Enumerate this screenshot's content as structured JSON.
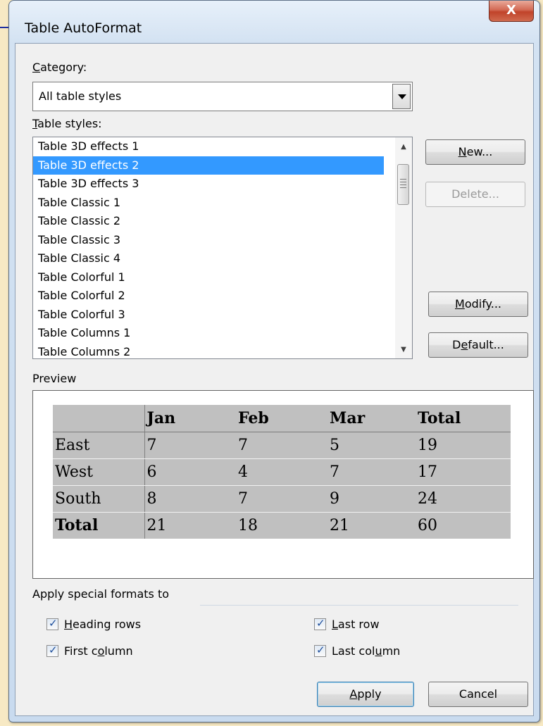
{
  "dialog": {
    "title": "Table AutoFormat",
    "close_symbol": "X"
  },
  "category": {
    "label_ul": "C",
    "label_rest": "ategory:",
    "value": "All table styles"
  },
  "table_styles": {
    "label_ul": "T",
    "label_rest": "able styles:",
    "selected_index": 1,
    "items": [
      "Table 3D effects 1",
      "Table 3D effects 2",
      "Table 3D effects 3",
      "Table Classic 1",
      "Table Classic 2",
      "Table Classic 3",
      "Table Classic 4",
      "Table Colorful 1",
      "Table Colorful 2",
      "Table Colorful 3",
      "Table Columns 1",
      "Table Columns 2"
    ]
  },
  "buttons": {
    "new_ul": "N",
    "new_rest": "ew...",
    "delete": "Delete...",
    "modify_ul": "M",
    "modify_rest": "odify...",
    "default_pre": "D",
    "default_ul": "e",
    "default_rest": "fault...",
    "apply_ul": "A",
    "apply_rest": "pply",
    "cancel": "Cancel"
  },
  "preview": {
    "label": "Preview",
    "rows": [
      [
        "",
        "Jan",
        "Feb",
        "Mar",
        "Total"
      ],
      [
        "East",
        "7",
        "7",
        "5",
        "19"
      ],
      [
        "West",
        "6",
        "4",
        "7",
        "17"
      ],
      [
        "South",
        "8",
        "7",
        "9",
        "24"
      ],
      [
        "Total",
        "21",
        "18",
        "21",
        "60"
      ]
    ]
  },
  "special_formats": {
    "label": "Apply special formats to",
    "heading_rows": {
      "pre": "",
      "ul": "H",
      "rest": "eading rows",
      "checked": true
    },
    "first_column": {
      "pre": "First c",
      "ul": "o",
      "rest": "lumn",
      "checked": true
    },
    "last_row": {
      "pre": "",
      "ul": "L",
      "rest": "ast row",
      "checked": true
    },
    "last_column": {
      "pre": "Last col",
      "ul": "u",
      "rest": "mn",
      "checked": true
    }
  }
}
